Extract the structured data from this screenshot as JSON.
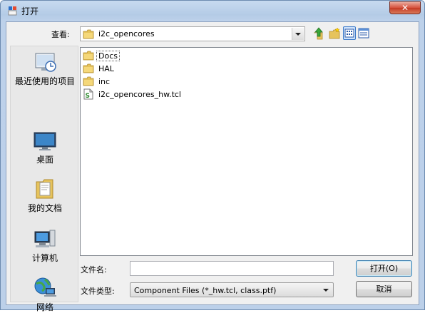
{
  "window": {
    "title": "打开",
    "close_label": "✕"
  },
  "lookin": {
    "label": "查看:",
    "value": "i2c_opencores"
  },
  "toolbar": {
    "view_menu_pressed": true
  },
  "places": [
    {
      "label": "最近使用的项目",
      "icon": "recent-items-icon"
    },
    {
      "label": "桌面",
      "icon": "desktop-icon"
    },
    {
      "label": "我的文档",
      "icon": "documents-icon"
    },
    {
      "label": "计算机",
      "icon": "computer-icon"
    },
    {
      "label": "网络",
      "icon": "network-icon"
    }
  ],
  "files": [
    {
      "name": "Docs",
      "type": "folder"
    },
    {
      "name": "HAL",
      "type": "folder"
    },
    {
      "name": "inc",
      "type": "folder"
    },
    {
      "name": "i2c_opencores_hw.tcl",
      "type": "tcl-script"
    }
  ],
  "filename": {
    "label": "文件名:",
    "value": ""
  },
  "filetype": {
    "label": "文件类型:",
    "value": "Component Files (*_hw.tcl, class.ptf)"
  },
  "buttons": {
    "open": "打开(O)",
    "cancel": "取消"
  }
}
